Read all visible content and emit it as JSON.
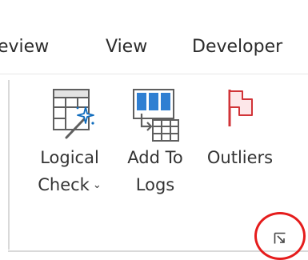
{
  "tabs": {
    "review": "eview",
    "view": "View",
    "developer": "Developer"
  },
  "ribbon_group": {
    "commands": [
      {
        "label_line1": "Logical",
        "label_line2": "Check",
        "has_dropdown": true,
        "dropdown_glyph": "⌄",
        "icon": "wand-grid-icon"
      },
      {
        "label_line1": "Add To",
        "label_line2": "Logs",
        "icon": "add-to-logs-icon"
      },
      {
        "label_line1": "Outliers",
        "icon": "flag-icon"
      }
    ],
    "dialog_launcher_icon": "dialog-launcher-icon"
  },
  "colors": {
    "flag_red": "#d13438",
    "flag_fill": "#fde7e9",
    "accent_blue": "#0f6cbd",
    "annotation_red": "#e51c1c"
  }
}
